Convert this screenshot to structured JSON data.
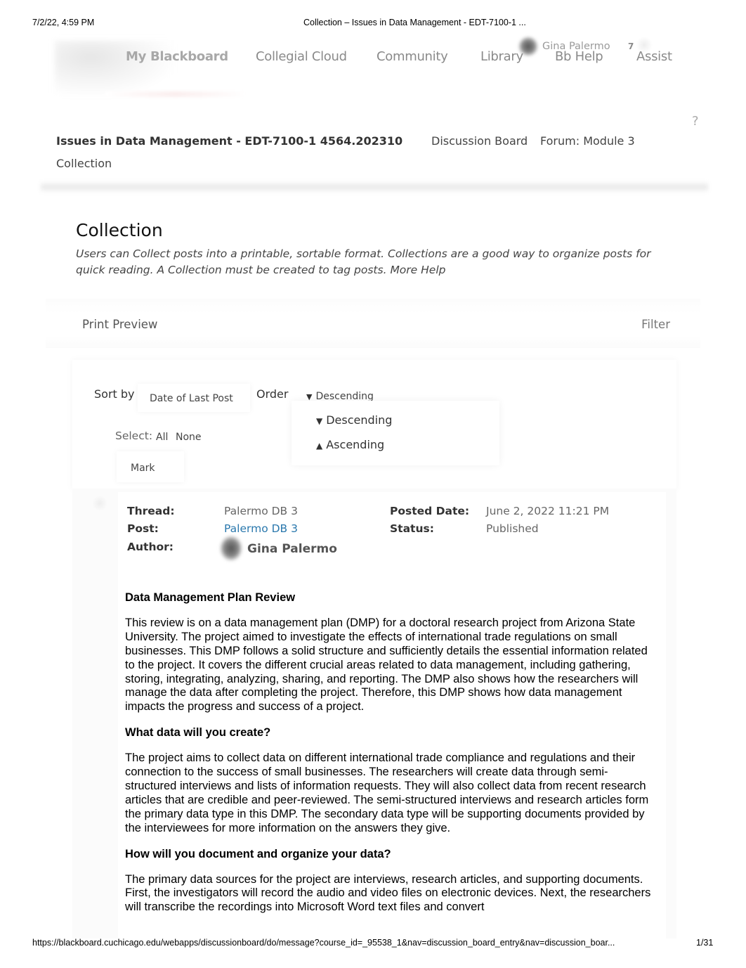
{
  "print": {
    "date": "7/2/22, 4:59 PM",
    "doc_title": "Collection – Issues in Data Management - EDT-7100-1 ...",
    "url": "https://blackboard.cuchicago.edu/webapps/discussionboard/do/message?course_id=_95538_1&nav=discussion_board_entry&nav=discussion_boar...",
    "page": "1/31"
  },
  "topnav": {
    "items": [
      {
        "label": "My Blackboard"
      },
      {
        "label": "Collegial Cloud"
      },
      {
        "label": "Community"
      },
      {
        "label": "Library"
      },
      {
        "label": "Bb Help"
      },
      {
        "label": "Assist"
      }
    ],
    "user_name": "Gina Palermo",
    "notification_count": "7"
  },
  "breadcrumb": {
    "help_icon": "?",
    "course": "Issues in Data Management - EDT-7100-1 4564.202310",
    "discussion_board": "Discussion Board",
    "forum": "Forum: Module 3",
    "current": "Collection"
  },
  "page": {
    "title": "Collection",
    "description": "Users can Collect posts into a printable, sortable format. Collections are a good way to organize posts for quick reading. A Collection must be created to tag posts.",
    "more_help": "More Help"
  },
  "action_bar": {
    "print_preview": "Print Preview",
    "filter": "Filter"
  },
  "sort": {
    "sort_by_label": "Sort by",
    "sort_by_value": "Date of Last Post",
    "order_label": "Order",
    "order_value": "Descending",
    "order_arrow": "▼",
    "order_options": [
      {
        "arrow": "▼",
        "label": "Descending"
      },
      {
        "arrow": "▲",
        "label": "Ascending"
      }
    ],
    "select_label": "Select:",
    "select_all": "All",
    "select_none": "None",
    "mark": "Mark"
  },
  "post": {
    "thread_label": "Thread:",
    "thread_value": "Palermo DB 3",
    "post_label": "Post:",
    "post_value": "Palermo DB 3",
    "author_label": "Author:",
    "author_value": "Gina Palermo",
    "posted_date_label": "Posted Date:",
    "posted_date_value": "June 2, 2022 11:21 PM",
    "status_label": "Status:",
    "status_value": "Published",
    "link_color": "#2a78ad",
    "body": {
      "heading1": "Data Management Plan Review",
      "para1": "This review is on a data management plan (DMP) for a doctoral research project from Arizona State University. The project aimed to investigate the effects of international trade regulations on small businesses. This DMP follows a solid structure and sufficiently details the essential information related to the project. It covers the different crucial areas related to data management, including gathering, storing, integrating, analyzing, sharing, and reporting. The DMP also shows how the researchers will manage the data after completing the project. Therefore, this DMP shows how data management impacts the progress and success of a project.",
      "heading2": "What data will you create?",
      "para2": "The project aims to collect data on different international trade compliance and regulations and their connection to the success of small businesses. The researchers will create data through semi-structured interviews and lists of information requests. They will also collect data from recent research articles that are credible and peer-reviewed. The semi-structured interviews and research articles form the primary data type in this DMP. The secondary data type will be supporting documents provided by the interviewees for more information on the answers they give.",
      "heading3": "How will you document and organize your data?",
      "para3": "The primary data sources for the project are interviews, research articles, and supporting documents. First, the investigators will record the audio and video files on electronic devices. Next, the researchers will transcribe the recordings into Microsoft Word text files and convert"
    }
  }
}
